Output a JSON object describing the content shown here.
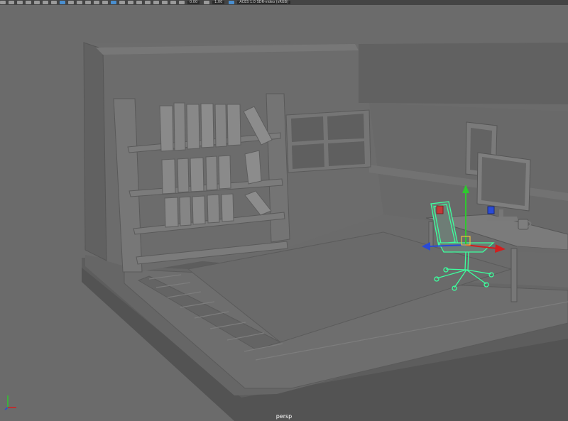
{
  "viewport": {
    "camera_label": "persp"
  },
  "toolbar": {
    "field_1": "0.00",
    "field_2": "1.00",
    "color_space": "ACES 1.0 SDR-video (sRGB)"
  },
  "colors": {
    "background": "#6b6b6b",
    "selection_wire": "#3dff9e",
    "axis_x": "#d21e1e",
    "axis_y": "#2ec92e",
    "axis_z": "#2a4bd6"
  }
}
